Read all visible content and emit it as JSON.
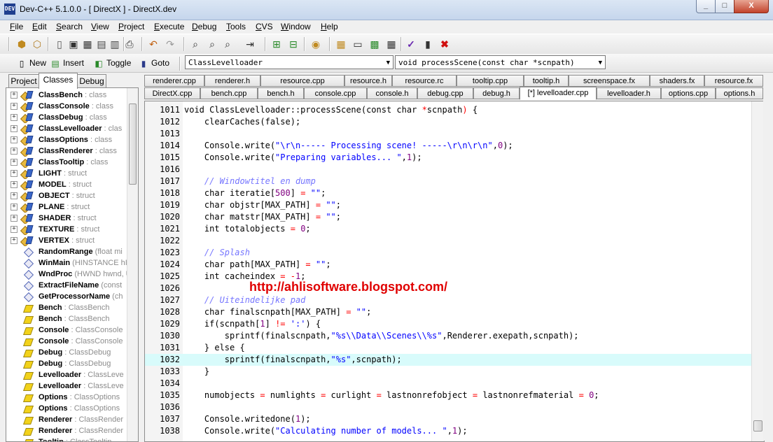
{
  "window": {
    "title": "Dev-C++ 5.1.0.0 - [ DirectX ] - DirectX.dev",
    "app_icon_text": "DEV",
    "min": "_",
    "max": "□",
    "close": "X"
  },
  "menu": [
    {
      "u": "F",
      "rest": "ile"
    },
    {
      "u": "E",
      "rest": "dit"
    },
    {
      "u": "S",
      "rest": "earch"
    },
    {
      "u": "V",
      "rest": "iew"
    },
    {
      "u": "P",
      "rest": "roject"
    },
    {
      "u": "E",
      "rest": "xecute"
    },
    {
      "u": "D",
      "rest": "ebug"
    },
    {
      "u": "T",
      "rest": "ools"
    },
    {
      "u": "C",
      "rest": "VS"
    },
    {
      "u": "W",
      "rest": "indow"
    },
    {
      "u": "H",
      "rest": "elp"
    }
  ],
  "toolbar2": {
    "new_label": "New",
    "insert_label": "Insert",
    "toggle_label": "Toggle",
    "goto_label": "Goto",
    "class_combo": "ClassLevelloader",
    "method_combo": "void processScene(const char *scnpath)"
  },
  "left_tabs": [
    "Project",
    "Classes",
    "Debug"
  ],
  "tree": [
    {
      "kind": "cls",
      "exp": "+",
      "name": "ClassBench",
      "type": " : class"
    },
    {
      "kind": "cls",
      "exp": "+",
      "name": "ClassConsole",
      "type": " : class"
    },
    {
      "kind": "cls",
      "exp": "+",
      "name": "ClassDebug",
      "type": " : class"
    },
    {
      "kind": "cls",
      "exp": "+",
      "name": "ClassLevelloader",
      "type": " : clas"
    },
    {
      "kind": "cls",
      "exp": "+",
      "name": "ClassOptions",
      "type": " : class"
    },
    {
      "kind": "cls",
      "exp": "+",
      "name": "ClassRenderer",
      "type": " : class"
    },
    {
      "kind": "cls",
      "exp": "+",
      "name": "ClassTooltip",
      "type": " : class"
    },
    {
      "kind": "cls",
      "exp": "+",
      "name": "LIGHT",
      "type": " : struct"
    },
    {
      "kind": "cls",
      "exp": "+",
      "name": "MODEL",
      "type": " : struct"
    },
    {
      "kind": "cls",
      "exp": "+",
      "name": "OBJECT",
      "type": " : struct"
    },
    {
      "kind": "cls",
      "exp": "+",
      "name": "PLANE",
      "type": " : struct"
    },
    {
      "kind": "cls",
      "exp": "+",
      "name": "SHADER",
      "type": " : struct"
    },
    {
      "kind": "cls",
      "exp": "+",
      "name": "TEXTURE",
      "type": " : struct"
    },
    {
      "kind": "cls",
      "exp": "+",
      "name": "VERTEX",
      "type": " : struct"
    },
    {
      "kind": "fn",
      "exp": "",
      "name": "RandomRange",
      "type": " (float mi"
    },
    {
      "kind": "fn",
      "exp": "",
      "name": "WinMain",
      "type": " (HINSTANCE hI"
    },
    {
      "kind": "fn",
      "exp": "",
      "name": "WndProc",
      "type": " (HWND hwnd, U"
    },
    {
      "kind": "fn",
      "exp": "",
      "name": "ExtractFileName",
      "type": " (const"
    },
    {
      "kind": "fn",
      "exp": "",
      "name": "GetProcessorName",
      "type": " (ch"
    },
    {
      "kind": "var",
      "exp": "",
      "name": "Bench",
      "type": " : ClassBench"
    },
    {
      "kind": "var",
      "exp": "",
      "name": "Bench",
      "type": " : ClassBench"
    },
    {
      "kind": "var",
      "exp": "",
      "name": "Console",
      "type": " : ClassConsole"
    },
    {
      "kind": "var",
      "exp": "",
      "name": "Console",
      "type": " : ClassConsole"
    },
    {
      "kind": "var",
      "exp": "",
      "name": "Debug",
      "type": " : ClassDebug"
    },
    {
      "kind": "var",
      "exp": "",
      "name": "Debug",
      "type": " : ClassDebug"
    },
    {
      "kind": "var",
      "exp": "",
      "name": "Levelloader",
      "type": " : ClassLeve"
    },
    {
      "kind": "var",
      "exp": "",
      "name": "Levelloader",
      "type": " : ClassLeve"
    },
    {
      "kind": "var",
      "exp": "",
      "name": "Options",
      "type": " : ClassOptions"
    },
    {
      "kind": "var",
      "exp": "",
      "name": "Options",
      "type": " : ClassOptions"
    },
    {
      "kind": "var",
      "exp": "",
      "name": "Renderer",
      "type": " : ClassRender"
    },
    {
      "kind": "var",
      "exp": "",
      "name": "Renderer",
      "type": " : ClassRender"
    },
    {
      "kind": "var",
      "exp": "",
      "name": "Tooltip",
      "type": " : ClassTooltip"
    }
  ],
  "file_tabs_row1": [
    "renderer.cpp",
    "renderer.h",
    "resource.cpp",
    "resource.h",
    "resource.rc",
    "tooltip.cpp",
    "tooltip.h",
    "screenspace.fx",
    "shaders.fx",
    "resource.fx"
  ],
  "file_tabs_row2": [
    "DirectX.cpp",
    "bench.cpp",
    "bench.h",
    "console.cpp",
    "console.h",
    "debug.cpp",
    "debug.h",
    "[*] levelloader.cpp",
    "levelloader.h",
    "options.cpp",
    "options.h"
  ],
  "active_tab": "[*] levelloader.cpp",
  "highlight_line": "1032",
  "code": [
    {
      "n": "1011",
      "segs": [
        [
          "k",
          "void ClassLevelloader::processScene(const char "
        ],
        [
          "p",
          "*"
        ],
        [
          "k",
          "scnpath"
        ],
        [
          "p",
          ")"
        ],
        [
          "k",
          " {"
        ]
      ]
    },
    {
      "n": "1012",
      "segs": [
        [
          "k",
          "    clearCaches(false);"
        ]
      ]
    },
    {
      "n": "1013",
      "segs": []
    },
    {
      "n": "1014",
      "segs": [
        [
          "k",
          "    Console.write("
        ],
        [
          "s",
          "\"\\r\\n----- Processing scene! -----\\r\\n\\r\\n\""
        ],
        [
          "k",
          ","
        ],
        [
          "n",
          "0"
        ],
        [
          "k",
          ");"
        ]
      ]
    },
    {
      "n": "1015",
      "segs": [
        [
          "k",
          "    Console.write("
        ],
        [
          "s",
          "\"Preparing variables... \""
        ],
        [
          "k",
          ","
        ],
        [
          "n",
          "1"
        ],
        [
          "k",
          ");"
        ]
      ]
    },
    {
      "n": "1016",
      "segs": []
    },
    {
      "n": "1017",
      "segs": [
        [
          "c",
          "    // Windowtitel en dump"
        ]
      ]
    },
    {
      "n": "1018",
      "segs": [
        [
          "k",
          "    char iteratie["
        ],
        [
          "n",
          "500"
        ],
        [
          "k",
          "] "
        ],
        [
          "p",
          "="
        ],
        [
          "k",
          " "
        ],
        [
          "s",
          "\"\""
        ],
        [
          "k",
          ";"
        ]
      ]
    },
    {
      "n": "1019",
      "segs": [
        [
          "k",
          "    char objstr[MAX_PATH] "
        ],
        [
          "p",
          "="
        ],
        [
          "k",
          " "
        ],
        [
          "s",
          "\"\""
        ],
        [
          "k",
          ";"
        ]
      ]
    },
    {
      "n": "1020",
      "segs": [
        [
          "k",
          "    char matstr[MAX_PATH] "
        ],
        [
          "p",
          "="
        ],
        [
          "k",
          " "
        ],
        [
          "s",
          "\"\""
        ],
        [
          "k",
          ";"
        ]
      ]
    },
    {
      "n": "1021",
      "segs": [
        [
          "k",
          "    int totalobjects "
        ],
        [
          "p",
          "="
        ],
        [
          "k",
          " "
        ],
        [
          "n",
          "0"
        ],
        [
          "k",
          ";"
        ]
      ]
    },
    {
      "n": "1022",
      "segs": []
    },
    {
      "n": "1023",
      "segs": [
        [
          "c",
          "    // Splash"
        ]
      ]
    },
    {
      "n": "1024",
      "segs": [
        [
          "k",
          "    char path[MAX_PATH] "
        ],
        [
          "p",
          "="
        ],
        [
          "k",
          " "
        ],
        [
          "s",
          "\"\""
        ],
        [
          "k",
          ";"
        ]
      ]
    },
    {
      "n": "1025",
      "segs": [
        [
          "k",
          "    int cacheindex "
        ],
        [
          "p",
          "="
        ],
        [
          "k",
          " "
        ],
        [
          "p",
          "-"
        ],
        [
          "n",
          "1"
        ],
        [
          "k",
          ";"
        ]
      ]
    },
    {
      "n": "1026",
      "segs": []
    },
    {
      "n": "1027",
      "segs": [
        [
          "c",
          "    // Uiteindelijke pad"
        ]
      ]
    },
    {
      "n": "1028",
      "segs": [
        [
          "k",
          "    char finalscnpath[MAX_PATH] "
        ],
        [
          "p",
          "="
        ],
        [
          "k",
          " "
        ],
        [
          "s",
          "\"\""
        ],
        [
          "k",
          ";"
        ]
      ]
    },
    {
      "n": "1029",
      "segs": [
        [
          "k",
          "    if(scnpath["
        ],
        [
          "n",
          "1"
        ],
        [
          "k",
          "] "
        ],
        [
          "p",
          "!="
        ],
        [
          "k",
          " "
        ],
        [
          "s",
          "':'"
        ],
        [
          "k",
          ") {"
        ]
      ]
    },
    {
      "n": "1030",
      "segs": [
        [
          "k",
          "        sprintf(finalscnpath,"
        ],
        [
          "s",
          "\"%s\\\\Data\\\\Scenes\\\\%s\""
        ],
        [
          "k",
          ",Renderer.exepath,scnpath);"
        ]
      ]
    },
    {
      "n": "1031",
      "segs": [
        [
          "k",
          "    } else {"
        ]
      ]
    },
    {
      "n": "1032",
      "segs": [
        [
          "k",
          "        sprintf(finalscnpath,"
        ],
        [
          "s",
          "\"%s\""
        ],
        [
          "k",
          ",scnpath);"
        ]
      ]
    },
    {
      "n": "1033",
      "segs": [
        [
          "k",
          "    }"
        ]
      ]
    },
    {
      "n": "1034",
      "segs": []
    },
    {
      "n": "1035",
      "segs": [
        [
          "k",
          "    numobjects "
        ],
        [
          "p",
          "="
        ],
        [
          "k",
          " numlights "
        ],
        [
          "p",
          "="
        ],
        [
          "k",
          " curlight "
        ],
        [
          "p",
          "="
        ],
        [
          "k",
          " lastnonrefobject "
        ],
        [
          "p",
          "="
        ],
        [
          "k",
          " lastnonrefmaterial "
        ],
        [
          "p",
          "="
        ],
        [
          "k",
          " "
        ],
        [
          "n",
          "0"
        ],
        [
          "k",
          ";"
        ]
      ]
    },
    {
      "n": "1036",
      "segs": []
    },
    {
      "n": "1037",
      "segs": [
        [
          "k",
          "    Console.writedone("
        ],
        [
          "n",
          "1"
        ],
        [
          "k",
          ");"
        ]
      ]
    },
    {
      "n": "1038",
      "segs": [
        [
          "k",
          "    Console.write("
        ],
        [
          "s",
          "\"Calculating number of models... \""
        ],
        [
          "k",
          ","
        ],
        [
          "n",
          "1"
        ],
        [
          "k",
          ");"
        ]
      ]
    }
  ],
  "watermark": "http://ahlisoftware.blogspot.com/"
}
